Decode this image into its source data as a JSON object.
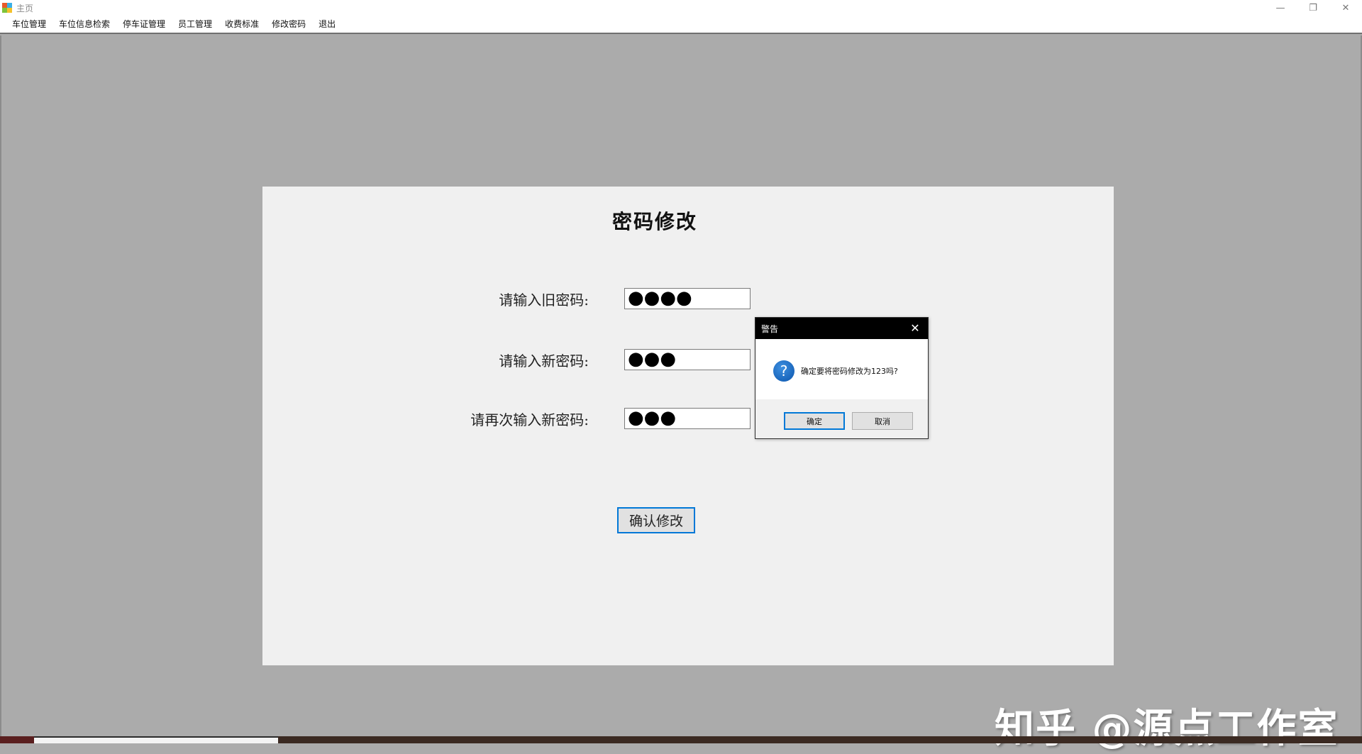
{
  "window": {
    "title": "主页",
    "minimize_glyph": "—",
    "restore_glyph": "❐",
    "close_glyph": "✕"
  },
  "menu": {
    "items": [
      {
        "label": "车位管理"
      },
      {
        "label": "车位信息检索"
      },
      {
        "label": "停车证管理"
      },
      {
        "label": "员工管理"
      },
      {
        "label": "收费标准"
      },
      {
        "label": "修改密码"
      },
      {
        "label": "退出"
      }
    ]
  },
  "form": {
    "title": "密码修改",
    "old_password_label": "请输入旧密码:",
    "old_password_value": "●●●●",
    "new_password_label": "请输入新密码:",
    "new_password_value": "●●●",
    "confirm_password_label": "请再次输入新密码:",
    "confirm_password_value": "●●●",
    "submit_label": "确认修改"
  },
  "dialog": {
    "title": "警告",
    "close_glyph": "✕",
    "icon": "question-icon",
    "icon_glyph": "?",
    "message": "确定要将密码修改为123吗?",
    "ok_label": "确定",
    "cancel_label": "取消"
  },
  "watermark": {
    "text": "知乎 @源点工作室"
  },
  "colors": {
    "mdi_background": "#ababab",
    "panel_background": "#f0f0f0",
    "focus_border": "#0078d7",
    "dialog_titlebar": "#000000"
  }
}
